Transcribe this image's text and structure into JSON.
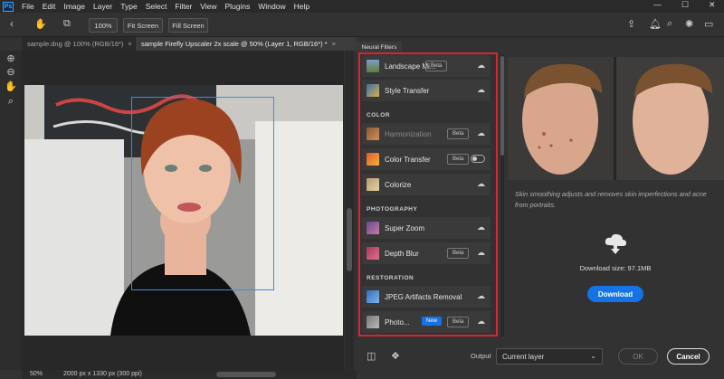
{
  "app": {
    "logo": "Ps"
  },
  "menu": [
    "File",
    "Edit",
    "Image",
    "Layer",
    "Type",
    "Select",
    "Filter",
    "View",
    "Plugins",
    "Window",
    "Help"
  ],
  "options_bar": {
    "zoom_btn": "100%",
    "fit_btn": "Fit Screen",
    "fill_btn": "Fill Screen"
  },
  "tabs": [
    {
      "label": "sample.dng @ 100% (RGB/16*)",
      "active": false
    },
    {
      "label": "sample Firefly Upscaler 2x scale @ 50% (Layer 1, RGB/16*) *",
      "active": true
    }
  ],
  "status": {
    "zoom": "50%",
    "dims": "2000 px x 1330 px (300 ppi)"
  },
  "neural_filters": {
    "panel_title": "Neural Filters",
    "filters": [
      {
        "label": "Landscape Mi...",
        "badge": "Beta",
        "new": false,
        "dim": false
      },
      {
        "label": "Style Transfer",
        "badge": "",
        "new": false,
        "dim": false
      },
      {
        "label": "Harmonization",
        "badge": "Beta",
        "new": false,
        "dim": true
      },
      {
        "label": "Color Transfer",
        "badge": "Beta",
        "new": false,
        "dim": false,
        "toggle": true
      },
      {
        "label": "Colorize",
        "badge": "",
        "new": false,
        "dim": false
      },
      {
        "label": "Super Zoom",
        "badge": "",
        "new": false,
        "dim": false
      },
      {
        "label": "Depth Blur",
        "badge": "Beta",
        "new": false,
        "dim": false
      },
      {
        "label": "JPEG Artifacts Removal",
        "badge": "",
        "new": false,
        "dim": false
      },
      {
        "label": "Photo...",
        "badge": "Beta",
        "new": true,
        "new_label": "New",
        "dim": false
      }
    ],
    "categories": {
      "color": "COLOR",
      "photography": "PHOTOGRAPHY",
      "restoration": "RESTORATION"
    }
  },
  "preview": {
    "description": "Skin smoothing adjusts and removes skin imperfections and acne from portraits.",
    "download_size": "Download size: 97.1MB",
    "download_button": "Download"
  },
  "bottom": {
    "output_label": "Output",
    "output_value": "Current layer",
    "ok": "OK",
    "cancel": "Cancel"
  },
  "colors": {
    "accent": "#1473e6",
    "highlight": "#d6262e",
    "selection": "#3b8de0"
  }
}
